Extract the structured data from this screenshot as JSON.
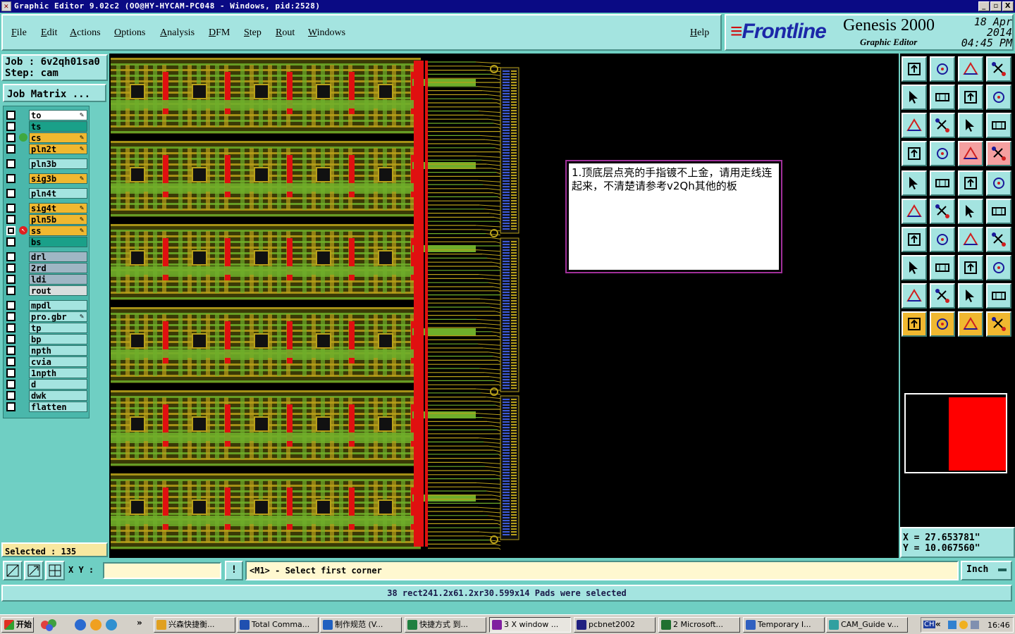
{
  "window": {
    "title": "Graphic Editor 9.02c2 (OO@HY-HYCAM-PC048 - Windows, pid:2528)",
    "controls": [
      "_",
      "▫",
      "X"
    ]
  },
  "menu": {
    "items": [
      "File",
      "Edit",
      "Actions",
      "Options",
      "Analysis",
      "DFM",
      "Step",
      "Rout",
      "Windows"
    ],
    "help": "Help"
  },
  "brand": {
    "logo": "Frontline",
    "product": "Genesis 2000",
    "subtitle": "Graphic Editor",
    "date": "18 Apr 2014",
    "time": "04:45 PM"
  },
  "job": {
    "job_label": "Job : 6v2qh01sa0",
    "step_label": "Step: cam",
    "matrix_button": "Job Matrix ..."
  },
  "layers": [
    {
      "name": "to",
      "color": "#ffffff",
      "checked": false,
      "pen": true
    },
    {
      "name": "ts",
      "color": "#1aa089",
      "checked": false,
      "pen": false
    },
    {
      "name": "cs",
      "color": "#f0b830",
      "checked": false,
      "pen": true,
      "dot": true
    },
    {
      "name": "pln2t",
      "color": "#f0b830",
      "checked": false,
      "pen": true
    },
    {
      "name": "pln3b",
      "color": "#a4e4e0",
      "checked": false,
      "pen": false
    },
    {
      "name": "sig3b",
      "color": "#f0b830",
      "checked": false,
      "pen": true
    },
    {
      "name": "pln4t",
      "color": "#a4e4e0",
      "checked": false,
      "pen": false
    },
    {
      "name": "sig4t",
      "color": "#f0b830",
      "checked": false,
      "pen": true
    },
    {
      "name": "pln5b",
      "color": "#f0b830",
      "checked": false,
      "pen": true
    },
    {
      "name": "ss",
      "color": "#f0b830",
      "checked": true,
      "pen": true,
      "work": true
    },
    {
      "name": "bs",
      "color": "#1aa089",
      "checked": false,
      "pen": false
    },
    {
      "name": "drl",
      "color": "#9fb6c4",
      "checked": false,
      "pen": false
    },
    {
      "name": "2rd",
      "color": "#9fb6c4",
      "checked": false,
      "pen": false
    },
    {
      "name": "ldi",
      "color": "#9fb6c4",
      "checked": false,
      "pen": false
    },
    {
      "name": "rout",
      "color": "#d8dede",
      "checked": false,
      "pen": false
    },
    {
      "name": "mpdl",
      "color": "#a4e4e0",
      "checked": false,
      "pen": false
    },
    {
      "name": "pro.gbr",
      "color": "#a4e4e0",
      "checked": false,
      "pen": true
    },
    {
      "name": "tp",
      "color": "#a4e4e0",
      "checked": false,
      "pen": false
    },
    {
      "name": "bp",
      "color": "#a4e4e0",
      "checked": false,
      "pen": false
    },
    {
      "name": "npth",
      "color": "#a4e4e0",
      "checked": false,
      "pen": false
    },
    {
      "name": "cvia",
      "color": "#a4e4e0",
      "checked": false,
      "pen": false
    },
    {
      "name": "1npth",
      "color": "#a4e4e0",
      "checked": false,
      "pen": false
    },
    {
      "name": "d",
      "color": "#a4e4e0",
      "checked": false,
      "pen": false
    },
    {
      "name": "dwk",
      "color": "#a4e4e0",
      "checked": false,
      "pen": false
    },
    {
      "name": "flatten",
      "color": "#a4e4e0",
      "checked": false,
      "pen": false
    }
  ],
  "selected": "Selected : 135",
  "note": "1.顶底层点亮的手指镀不上金，请用走线连起来，不清楚请参考v2Qh其他的板",
  "coords": {
    "x": "X  =  27.653781\"",
    "y": "Y  =  10.067560\""
  },
  "status": {
    "xy_label": "X Y :",
    "xy_value": "",
    "bang": "!",
    "prompt": "<M1> - Select first corner",
    "units": "Inch"
  },
  "result": "38 rect241.2x61.2xr30.599x14 Pads were selected",
  "taskbar": {
    "start": "开始",
    "tasks": [
      {
        "label": "兴森快捷衡...",
        "icon": "#e0a020"
      },
      {
        "label": "Total Comma...",
        "icon": "#2050b0"
      },
      {
        "label": "制作规范 (V...",
        "icon": "#2060c0"
      },
      {
        "label": "快捷方式 到...",
        "icon": "#208040"
      },
      {
        "label": "3 X window ...",
        "icon": "#8020a0",
        "active": true
      },
      {
        "label": "pcbnet2002",
        "icon": "#202080"
      },
      {
        "label": "2 Microsoft...",
        "icon": "#207030"
      },
      {
        "label": "Temporary I...",
        "icon": "#3060c0"
      },
      {
        "label": "CAM_Guide v...",
        "icon": "#30a0a0"
      }
    ],
    "tray_lang": "CH",
    "clock": "16:46"
  }
}
